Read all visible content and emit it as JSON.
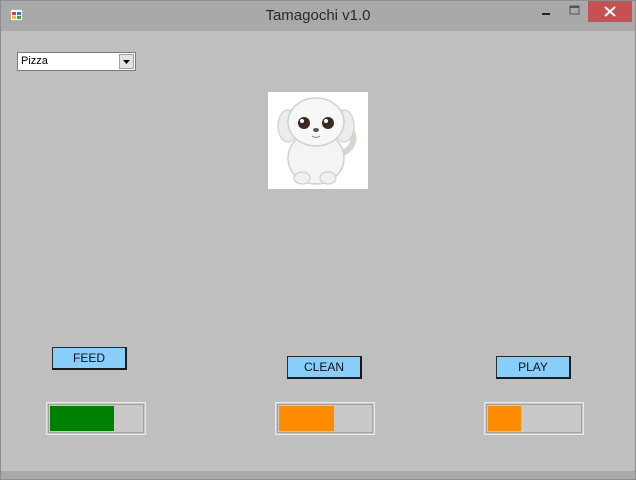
{
  "window": {
    "title": "Tamagochi v1.0"
  },
  "food_select": {
    "selected": "Pizza"
  },
  "pet": {
    "image": "white-puppy"
  },
  "actions": {
    "feed_label": "FEED",
    "clean_label": "CLEAN",
    "play_label": "PLAY"
  },
  "stats": {
    "feed": {
      "percent": 70,
      "color": "#008000"
    },
    "clean": {
      "percent": 60,
      "color": "#ff8c00"
    },
    "play": {
      "percent": 36,
      "color": "#ff8c00"
    }
  },
  "colors": {
    "button_bg": "#87cefa",
    "close_button": "#c75050",
    "window_bg": "#bfbfbf"
  }
}
